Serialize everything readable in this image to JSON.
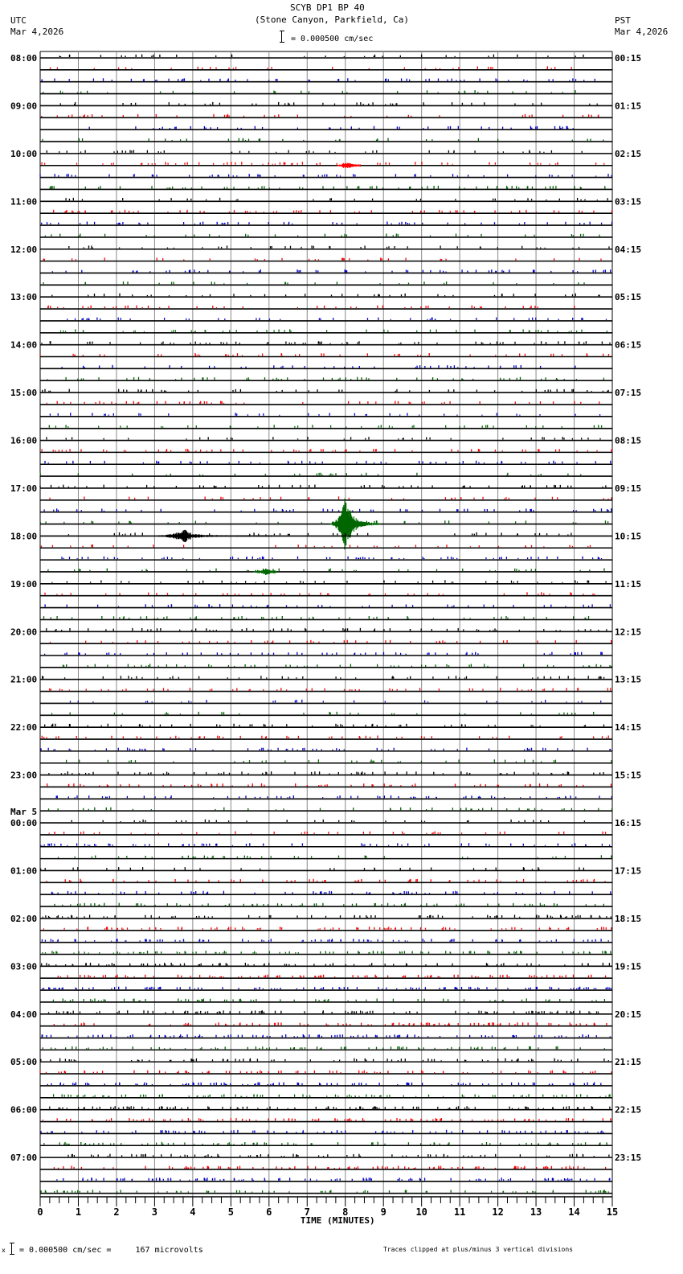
{
  "header": {
    "title": "SCYB DP1 BP 40",
    "subtitle": "(Stone Canyon, Parkfield, Ca)",
    "left_tz": "UTC",
    "left_date": "Mar 4,2026",
    "right_tz": "PST",
    "right_date": "Mar 4,2026",
    "scale": "= 0.000500 cm/sec"
  },
  "footer": {
    "scale": "= 0.000500 cm/sec =     167 microvolts",
    "scale_prefix": "x",
    "clip_note": "Traces clipped at plus/minus 3 vertical divisions"
  },
  "chart_data": {
    "type": "line",
    "title": "SCYB DP1 BP 40",
    "xlabel": "TIME (MINUTES)",
    "xlim": [
      0,
      15
    ],
    "x_ticks": [
      "0",
      "1",
      "2",
      "3",
      "4",
      "5",
      "6",
      "7",
      "8",
      "9",
      "10",
      "11",
      "12",
      "13",
      "14",
      "15"
    ],
    "traces_per_hour": 4,
    "trace_colors": [
      "#000000",
      "#ff0000",
      "#0000cc",
      "#006600"
    ],
    "left_labels": [
      "08:00",
      "09:00",
      "10:00",
      "11:00",
      "12:00",
      "13:00",
      "14:00",
      "15:00",
      "16:00",
      "17:00",
      "18:00",
      "19:00",
      "20:00",
      "21:00",
      "22:00",
      "23:00",
      "00:00",
      "01:00",
      "02:00",
      "03:00",
      "04:00",
      "05:00",
      "06:00",
      "07:00"
    ],
    "date_change_label": "Mar 5",
    "right_labels": [
      "00:15",
      "01:15",
      "02:15",
      "03:15",
      "04:15",
      "05:15",
      "06:15",
      "07:15",
      "08:15",
      "09:15",
      "10:15",
      "11:15",
      "12:15",
      "13:15",
      "14:15",
      "15:15",
      "16:15",
      "17:15",
      "18:15",
      "19:15",
      "20:15",
      "21:15",
      "22:15",
      "23:15"
    ],
    "events": [
      {
        "hour": "10:00",
        "trace": 1,
        "start_min": 7.8,
        "end_min": 8.4,
        "peak_min": 8.0,
        "amplitude": 0.2
      },
      {
        "hour": "17:00",
        "trace": 3,
        "start_min": 7.6,
        "end_min": 8.9,
        "peak_min": 8.0,
        "amplitude": 1.0
      },
      {
        "hour": "18:00",
        "trace": 0,
        "start_min": 3.1,
        "end_min": 6.1,
        "peak_min": 3.8,
        "amplitude": 0.35
      },
      {
        "hour": "18:00",
        "trace": 3,
        "start_min": 5.6,
        "end_min": 6.2,
        "peak_min": 5.9,
        "amplitude": 0.2
      }
    ]
  }
}
